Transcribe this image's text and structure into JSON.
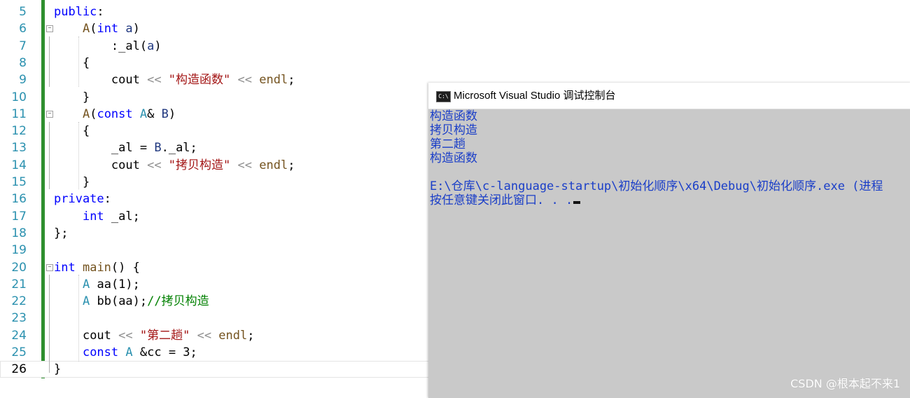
{
  "editor": {
    "lines": [
      {
        "num": "5",
        "tokens": [
          {
            "t": "public",
            "c": "kw"
          },
          {
            "t": ":",
            "c": "pl"
          }
        ]
      },
      {
        "num": "6",
        "tokens": [
          {
            "t": "    ",
            "c": "pl"
          },
          {
            "t": "A",
            "c": "fn"
          },
          {
            "t": "(",
            "c": "pl"
          },
          {
            "t": "int",
            "c": "kw"
          },
          {
            "t": " ",
            "c": "pl"
          },
          {
            "t": "a",
            "c": "id"
          },
          {
            "t": ")",
            "c": "pl"
          }
        ]
      },
      {
        "num": "7",
        "tokens": [
          {
            "t": "        ",
            "c": "pl"
          },
          {
            "t": ":",
            "c": "pl"
          },
          {
            "t": "_al",
            "c": "pl"
          },
          {
            "t": "(",
            "c": "pl"
          },
          {
            "t": "a",
            "c": "id"
          },
          {
            "t": ")",
            "c": "pl"
          }
        ]
      },
      {
        "num": "8",
        "tokens": [
          {
            "t": "    ",
            "c": "pl"
          },
          {
            "t": "{",
            "c": "pl"
          }
        ]
      },
      {
        "num": "9",
        "tokens": [
          {
            "t": "        ",
            "c": "pl"
          },
          {
            "t": "cout",
            "c": "pl"
          },
          {
            "t": " << ",
            "c": "pn"
          },
          {
            "t": "\"构造函数\"",
            "c": "st"
          },
          {
            "t": " << ",
            "c": "pn"
          },
          {
            "t": "endl",
            "c": "fn"
          },
          {
            "t": ";",
            "c": "pl"
          }
        ]
      },
      {
        "num": "10",
        "tokens": [
          {
            "t": "    ",
            "c": "pl"
          },
          {
            "t": "}",
            "c": "pl"
          }
        ]
      },
      {
        "num": "11",
        "tokens": [
          {
            "t": "    ",
            "c": "pl"
          },
          {
            "t": "A",
            "c": "fn"
          },
          {
            "t": "(",
            "c": "pl"
          },
          {
            "t": "const",
            "c": "kw"
          },
          {
            "t": " ",
            "c": "pl"
          },
          {
            "t": "A",
            "c": "ty"
          },
          {
            "t": "& ",
            "c": "pl"
          },
          {
            "t": "B",
            "c": "id"
          },
          {
            "t": ")",
            "c": "pl"
          }
        ]
      },
      {
        "num": "12",
        "tokens": [
          {
            "t": "    ",
            "c": "pl"
          },
          {
            "t": "{",
            "c": "pl"
          }
        ]
      },
      {
        "num": "13",
        "tokens": [
          {
            "t": "        ",
            "c": "pl"
          },
          {
            "t": "_al",
            "c": "pl"
          },
          {
            "t": " = ",
            "c": "pl"
          },
          {
            "t": "B",
            "c": "id"
          },
          {
            "t": ".",
            "c": "pl"
          },
          {
            "t": "_al",
            "c": "pl"
          },
          {
            "t": ";",
            "c": "pl"
          }
        ]
      },
      {
        "num": "14",
        "tokens": [
          {
            "t": "        ",
            "c": "pl"
          },
          {
            "t": "cout",
            "c": "pl"
          },
          {
            "t": " << ",
            "c": "pn"
          },
          {
            "t": "\"拷贝构造\"",
            "c": "st"
          },
          {
            "t": " << ",
            "c": "pn"
          },
          {
            "t": "endl",
            "c": "fn"
          },
          {
            "t": ";",
            "c": "pl"
          }
        ]
      },
      {
        "num": "15",
        "tokens": [
          {
            "t": "    ",
            "c": "pl"
          },
          {
            "t": "}",
            "c": "pl"
          }
        ]
      },
      {
        "num": "16",
        "tokens": [
          {
            "t": "private",
            "c": "kw"
          },
          {
            "t": ":",
            "c": "pl"
          }
        ]
      },
      {
        "num": "17",
        "tokens": [
          {
            "t": "    ",
            "c": "pl"
          },
          {
            "t": "int",
            "c": "kw"
          },
          {
            "t": " _al;",
            "c": "pl"
          }
        ]
      },
      {
        "num": "18",
        "tokens": [
          {
            "t": "};",
            "c": "pl"
          }
        ]
      },
      {
        "num": "19",
        "tokens": []
      },
      {
        "num": "20",
        "tokens": [
          {
            "t": "int",
            "c": "kw"
          },
          {
            "t": " ",
            "c": "pl"
          },
          {
            "t": "main",
            "c": "fn"
          },
          {
            "t": "() {",
            "c": "pl"
          }
        ]
      },
      {
        "num": "21",
        "tokens": [
          {
            "t": "    ",
            "c": "pl"
          },
          {
            "t": "A",
            "c": "ty"
          },
          {
            "t": " ",
            "c": "pl"
          },
          {
            "t": "aa",
            "c": "pl"
          },
          {
            "t": "(1);",
            "c": "pl"
          }
        ]
      },
      {
        "num": "22",
        "tokens": [
          {
            "t": "    ",
            "c": "pl"
          },
          {
            "t": "A",
            "c": "ty"
          },
          {
            "t": " ",
            "c": "pl"
          },
          {
            "t": "bb",
            "c": "pl"
          },
          {
            "t": "(",
            "c": "pl"
          },
          {
            "t": "aa",
            "c": "pl"
          },
          {
            "t": ");",
            "c": "pl"
          },
          {
            "t": "//拷贝构造",
            "c": "cm"
          }
        ]
      },
      {
        "num": "23",
        "tokens": []
      },
      {
        "num": "24",
        "tokens": [
          {
            "t": "    ",
            "c": "pl"
          },
          {
            "t": "cout",
            "c": "pl"
          },
          {
            "t": " << ",
            "c": "pn"
          },
          {
            "t": "\"第二趟\"",
            "c": "st"
          },
          {
            "t": " << ",
            "c": "pn"
          },
          {
            "t": "endl",
            "c": "fn"
          },
          {
            "t": ";",
            "c": "pl"
          }
        ]
      },
      {
        "num": "25",
        "tokens": [
          {
            "t": "    ",
            "c": "pl"
          },
          {
            "t": "const",
            "c": "kw"
          },
          {
            "t": " ",
            "c": "pl"
          },
          {
            "t": "A",
            "c": "ty"
          },
          {
            "t": " &cc = 3;",
            "c": "pl"
          }
        ]
      },
      {
        "num": "26",
        "tokens": [
          {
            "t": "}",
            "c": "pl"
          }
        ],
        "current": true
      }
    ]
  },
  "console": {
    "title": "Microsoft Visual Studio 调试控制台",
    "icon_text": "C:\\",
    "output_lines": [
      "构造函数",
      "拷贝构造",
      "第二趟",
      "构造函数",
      "",
      "E:\\仓库\\c-language-startup\\初始化顺序\\x64\\Debug\\初始化顺序.exe (进程",
      "按任意键关闭此窗口. . ."
    ]
  },
  "watermark": "CSDN @根本起不来1",
  "colors": {
    "keyword": "#0000ff",
    "type": "#2b91af",
    "string": "#a31515",
    "comment": "#008000",
    "console_text": "#1a3ec8",
    "console_bg": "#c9c9c9",
    "change_bar": "#2f8f2f"
  }
}
